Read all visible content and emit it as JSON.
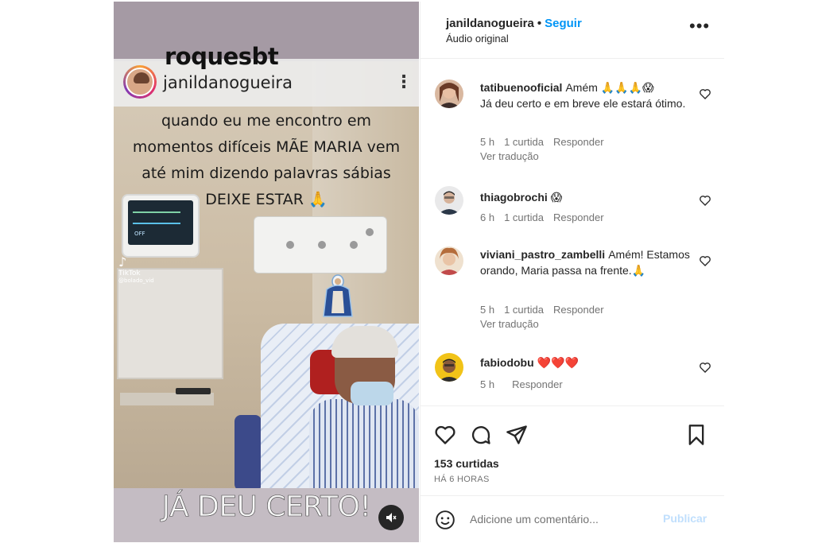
{
  "media": {
    "overlay_username": "roquesbt",
    "story_username": "janildanogueira",
    "caption_lines": [
      "quando eu me encontro em",
      "momentos difíceis MÃE MARIA vem",
      "até mim dizendo palavras sábias",
      "DEIXE ESTAR 🙏"
    ],
    "tiktok_label": "TikTok",
    "tiktok_handle": "@bolado_vid",
    "monitor_text": "OFF",
    "bottom_text": "JÁ DEU CERTO!"
  },
  "header": {
    "username": "janildanogueira",
    "separator": "•",
    "follow_label": "Seguir",
    "audio_label": "Áudio original",
    "more_label": "•••"
  },
  "comments": [
    {
      "username": "tatibuenooficial",
      "text": "Amém 🙏🙏🙏😱",
      "text2": "Já deu certo e em breve ele estará ótimo.",
      "time": "5 h",
      "likes": "1 curtida",
      "reply": "Responder",
      "translate": "Ver tradução",
      "avatar_color": "#8a4f3c"
    },
    {
      "username": "thiagobrochi",
      "text": "😱",
      "time": "6 h",
      "likes": "1 curtida",
      "reply": "Responder",
      "avatar_color": "#3d3d4a"
    },
    {
      "username": "viviani_pastro_zambelli",
      "text": "Amém! Estamos orando, Maria passa na frente.🙏",
      "time": "5 h",
      "likes": "1 curtida",
      "reply": "Responder",
      "translate": "Ver tradução",
      "avatar_color": "#c98a5e"
    },
    {
      "username": "fabiodobu",
      "text": "❤️❤️❤️",
      "time": "5 h",
      "reply": "Responder",
      "avatar_color": "#e8b81a"
    }
  ],
  "actions": {
    "likes": "153 curtidas",
    "time": "HÁ 6 HORAS"
  },
  "add_comment": {
    "placeholder": "Adicione um comentário...",
    "publish_label": "Publicar"
  }
}
